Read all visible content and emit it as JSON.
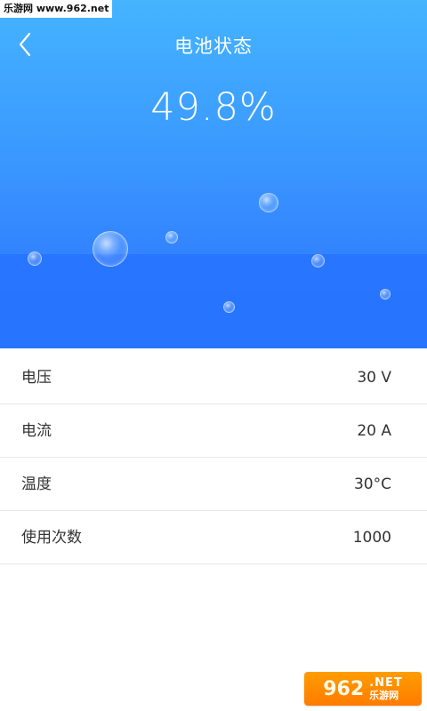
{
  "watermark": {
    "top": "乐游网 www.962.net",
    "bottom_num": "962",
    "bottom_net": ".NET",
    "bottom_cn": "乐游网"
  },
  "header": {
    "title": "电池状态",
    "back_icon": "chevron-left-icon"
  },
  "battery": {
    "percent": "49.8%"
  },
  "stats": [
    {
      "label": "电压",
      "value": "30 V"
    },
    {
      "label": "电流",
      "value": "20 A"
    },
    {
      "label": "温度",
      "value": "30°C"
    },
    {
      "label": "使用次数",
      "value": "1000"
    }
  ],
  "colors": {
    "hero_top": "#45b4ff",
    "hero_bottom": "#2f7bff",
    "divider": "#e8e8e8",
    "text": "#333333",
    "title": "#ffffff"
  }
}
